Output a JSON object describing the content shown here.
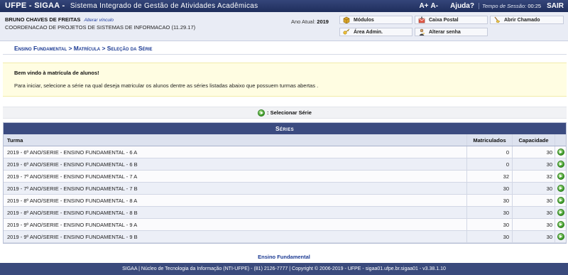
{
  "topbar": {
    "app_name": "UFPE - SIGAA -",
    "subtitle": "Sistema Integrado de Gestão de Atividades Acadêmicas",
    "font_increase": "A+",
    "font_decrease": "A-",
    "help": "Ajuda?",
    "session_label": "Tempo de Sessão:",
    "session_time": "00:25",
    "exit": "SAIR"
  },
  "user": {
    "name": "BRUNO CHAVES DE FREITAS",
    "change_link": "Alterar vínculo",
    "department": "COORDENACAO DE PROJETOS DE SISTEMAS DE INFORMACAO (11.29.17)",
    "year_label": "Ano Atual:",
    "year_value": "2019"
  },
  "quick_links": {
    "modulos": "Módulos",
    "caixa_postal": "Caixa Postal",
    "abrir_chamado": "Abrir Chamado",
    "area_admin": "Área Admin.",
    "alterar_senha": "Alterar senha"
  },
  "breadcrumb": "Ensino Fundamental > Matrícula > Seleção da Série",
  "notice": {
    "title": "Bem vindo à matrícula de alunos!",
    "text": "Para iniciar, selecione a série na qual deseja matricular os alunos dentre as séries listadas abaixo que possuem turmas abertas ."
  },
  "legend": {
    "label": ": Selecionar Série"
  },
  "table": {
    "caption": "Séries",
    "headers": {
      "turma": "Turma",
      "matriculados": "Matriculados",
      "capacidade": "Capacidade"
    },
    "rows": [
      {
        "turma": "2019 - 6º ANO/SERIE - ENSINO FUNDAMENTAL - 6 A",
        "matriculados": "0",
        "capacidade": "30"
      },
      {
        "turma": "2019 - 6º ANO/SERIE - ENSINO FUNDAMENTAL - 6 B",
        "matriculados": "0",
        "capacidade": "30"
      },
      {
        "turma": "2019 - 7º ANO/SERIE - ENSINO FUNDAMENTAL - 7 A",
        "matriculados": "32",
        "capacidade": "32"
      },
      {
        "turma": "2019 - 7º ANO/SERIE - ENSINO FUNDAMENTAL - 7 B",
        "matriculados": "30",
        "capacidade": "30"
      },
      {
        "turma": "2019 - 8º ANO/SERIE - ENSINO FUNDAMENTAL - 8 A",
        "matriculados": "30",
        "capacidade": "30"
      },
      {
        "turma": "2019 - 8º ANO/SERIE - ENSINO FUNDAMENTAL - 8 B",
        "matriculados": "30",
        "capacidade": "30"
      },
      {
        "turma": "2019 - 9º ANO/SERIE - ENSINO FUNDAMENTAL - 9 A",
        "matriculados": "30",
        "capacidade": "30"
      },
      {
        "turma": "2019 - 9º ANO/SERIE - ENSINO FUNDAMENTAL - 9 B",
        "matriculados": "30",
        "capacidade": "30"
      }
    ]
  },
  "footer": {
    "link": "Ensino Fundamental",
    "text": "SIGAA | Núcleo de Tecnologia da Informação (NTI-UFPE) - (81) 2126-7777 | Copyright © 2006-2019 - UFPE - sigaa01.ufpe.br.sigaa01 - v3.38.1.10"
  },
  "colors": {
    "header_bg": "#2a3a6b",
    "accent_link": "#1b3a93",
    "notice_bg": "#fffde2",
    "select_icon": "#3c9a28"
  },
  "icons": [
    "box-icon",
    "mail-icon",
    "broom-icon",
    "key-icon",
    "user-key-icon",
    "arrow-right-green-icon"
  ]
}
